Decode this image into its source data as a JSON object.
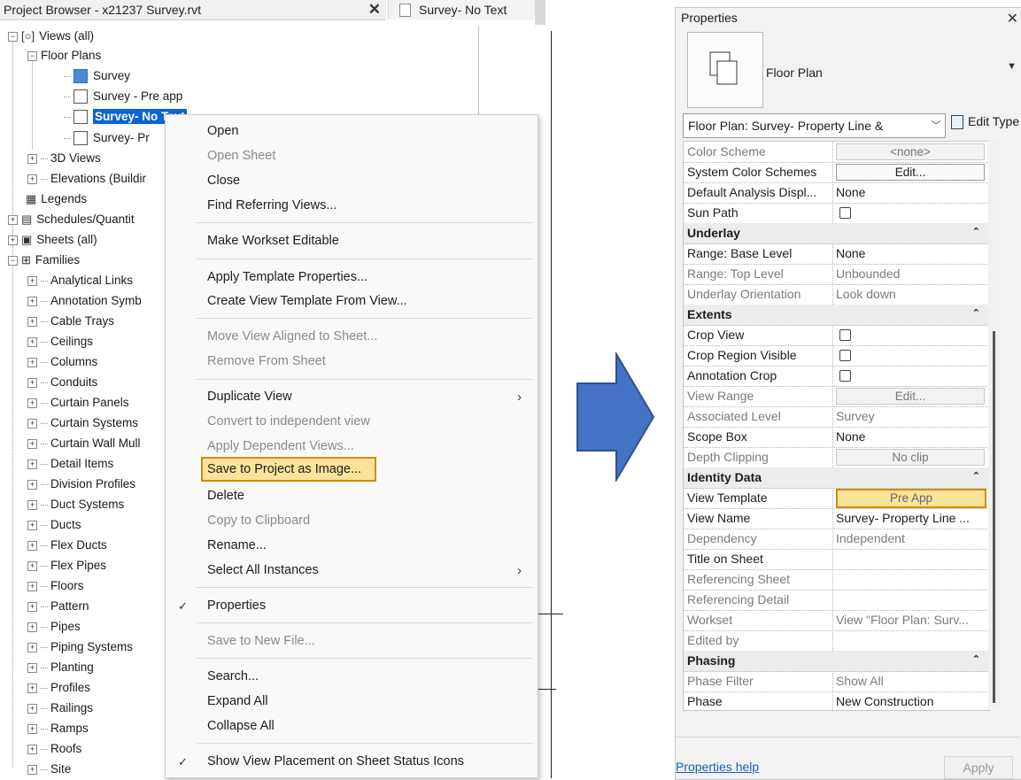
{
  "browser": {
    "title": "Project Browser - x21237 Survey.rvt",
    "items": [
      {
        "label": "Views (all)"
      },
      {
        "label": "Floor Plans"
      },
      {
        "label": "Survey"
      },
      {
        "label": "Survey - Pre app"
      },
      {
        "label": "Survey- No Text"
      },
      {
        "label": "Survey- Pr"
      },
      {
        "label": "3D Views"
      },
      {
        "label": "Elevations (Buildir"
      },
      {
        "label": "Legends"
      },
      {
        "label": "Schedules/Quantit"
      },
      {
        "label": "Sheets (all)"
      },
      {
        "label": "Families"
      }
    ],
    "families": [
      "Analytical Links",
      "Annotation Symb",
      "Cable Trays",
      "Ceilings",
      "Columns",
      "Conduits",
      "Curtain Panels",
      "Curtain Systems",
      "Curtain Wall Mull",
      "Detail Items",
      "Division Profiles",
      "Duct Systems",
      "Ducts",
      "Flex Ducts",
      "Flex Pipes",
      "Floors",
      "Pattern",
      "Pipes",
      "Piping Systems",
      "Planting",
      "Profiles",
      "Railings",
      "Ramps",
      "Roofs",
      "Site"
    ]
  },
  "view_tab": {
    "title": "Survey- No Text"
  },
  "context_menu": {
    "items": [
      "Open",
      "Open Sheet",
      "Close",
      "Find Referring Views...",
      "Make Workset Editable",
      "Apply Template Properties...",
      "Create View Template From View...",
      "Move View Aligned to Sheet...",
      "Remove From Sheet",
      "Duplicate View",
      "Convert to independent view",
      "Apply Dependent Views...",
      "Save to Project as Image...",
      "Delete",
      "Copy to Clipboard",
      "Rename...",
      "Select All Instances",
      "Properties",
      "Save to New File...",
      "Search...",
      "Expand All",
      "Collapse All",
      "Show View Placement on Sheet Status Icons"
    ]
  },
  "properties": {
    "title": "Properties",
    "type_name": "Floor Plan",
    "instance_select": "Floor Plan: Survey- Property Line &",
    "edit_type": "Edit Type",
    "rows": [
      {
        "name": "Color Scheme",
        "value": "<none>"
      },
      {
        "name": "System Color Schemes",
        "value": "Edit..."
      },
      {
        "name": "Default Analysis Displ...",
        "value": "None"
      },
      {
        "name": "Sun Path",
        "value": ""
      },
      {
        "name": "Underlay",
        "value": ""
      },
      {
        "name": "Range: Base Level",
        "value": "None"
      },
      {
        "name": "Range: Top Level",
        "value": "Unbounded"
      },
      {
        "name": "Underlay Orientation",
        "value": "Look down"
      },
      {
        "name": "Extents",
        "value": ""
      },
      {
        "name": "Crop View",
        "value": ""
      },
      {
        "name": "Crop Region Visible",
        "value": ""
      },
      {
        "name": "Annotation Crop",
        "value": ""
      },
      {
        "name": "View Range",
        "value": "Edit..."
      },
      {
        "name": "Associated Level",
        "value": "Survey"
      },
      {
        "name": "Scope Box",
        "value": "None"
      },
      {
        "name": "Depth Clipping",
        "value": "No clip"
      },
      {
        "name": "Identity Data",
        "value": ""
      },
      {
        "name": "View Template",
        "value": "Pre App"
      },
      {
        "name": "View Name",
        "value": "Survey- Property Line ..."
      },
      {
        "name": "Dependency",
        "value": "Independent"
      },
      {
        "name": "Title on Sheet",
        "value": ""
      },
      {
        "name": "Referencing Sheet",
        "value": ""
      },
      {
        "name": "Referencing Detail",
        "value": ""
      },
      {
        "name": "Workset",
        "value": "View \"Floor Plan: Surv..."
      },
      {
        "name": "Edited by",
        "value": ""
      },
      {
        "name": "Phasing",
        "value": ""
      },
      {
        "name": "Phase Filter",
        "value": "Show All"
      },
      {
        "name": "Phase",
        "value": "New Construction"
      }
    ],
    "help_link": "Properties help",
    "apply": "Apply"
  },
  "colors": {
    "highlight": "#fbe39a",
    "highlight_border": "#c98f08",
    "selection": "#0b63d6",
    "arrow": "#4472c4"
  }
}
